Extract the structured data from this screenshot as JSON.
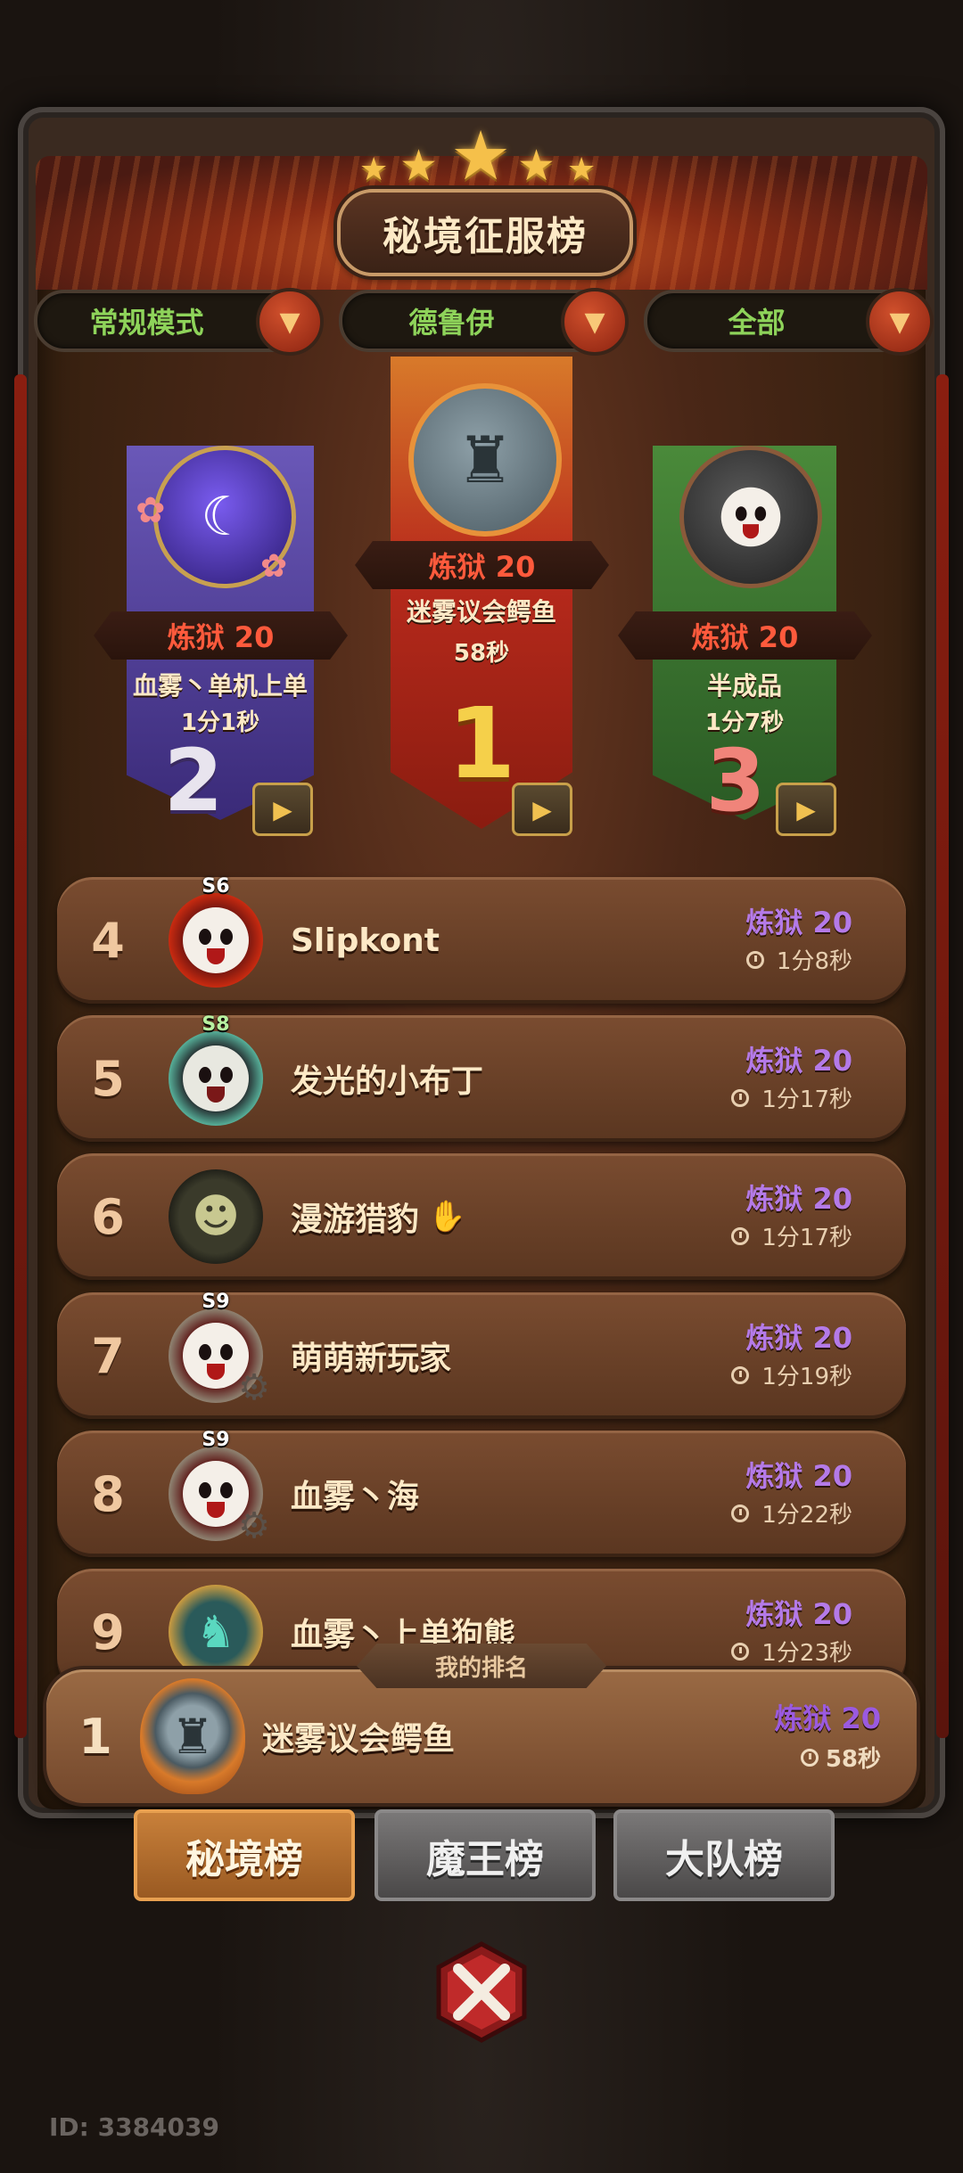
{
  "title": "秘境征服榜",
  "filters": [
    {
      "label": "常规模式"
    },
    {
      "label": "德鲁伊"
    },
    {
      "label": "全部"
    }
  ],
  "podium": {
    "first": {
      "rank": "1",
      "difficulty": "炼狱 20",
      "name": "迷雾议会鳄鱼",
      "time": "58秒"
    },
    "second": {
      "rank": "2",
      "difficulty": "炼狱 20",
      "name": "血雾丶单机上单",
      "time": "1分1秒"
    },
    "third": {
      "rank": "3",
      "difficulty": "炼狱 20",
      "name": "半成品",
      "time": "1分7秒"
    }
  },
  "rows": [
    {
      "rank": "4",
      "name": "Slipkont",
      "difficulty": "炼狱 20",
      "time": "1分8秒",
      "season": "S6"
    },
    {
      "rank": "5",
      "name": "发光的小布丁",
      "difficulty": "炼狱 20",
      "time": "1分17秒",
      "season": "S8"
    },
    {
      "rank": "6",
      "name": "漫游猎豹",
      "difficulty": "炼狱 20",
      "time": "1分17秒",
      "season": ""
    },
    {
      "rank": "7",
      "name": "萌萌新玩家",
      "difficulty": "炼狱 20",
      "time": "1分19秒",
      "season": "S9"
    },
    {
      "rank": "8",
      "name": "血雾丶海",
      "difficulty": "炼狱 20",
      "time": "1分22秒",
      "season": "S9"
    },
    {
      "rank": "9",
      "name": "血雾丶上单狗熊",
      "difficulty": "炼狱 20",
      "time": "1分23秒",
      "season": ""
    }
  ],
  "my_rank": {
    "label": "我的排名",
    "rank": "1",
    "name": "迷雾议会鳄鱼",
    "difficulty": "炼狱 20",
    "time": "58秒"
  },
  "tabs": [
    {
      "label": "秘境榜",
      "active": true
    },
    {
      "label": "魔王榜",
      "active": false
    },
    {
      "label": "大队榜",
      "active": false
    }
  ],
  "player_id": "ID: 3384039",
  "colors": {
    "difficulty_red": "#ff5a3c",
    "difficulty_purple": "#b47ae8",
    "filter_green": "#8ed35a",
    "gold": "#f5c04a"
  }
}
